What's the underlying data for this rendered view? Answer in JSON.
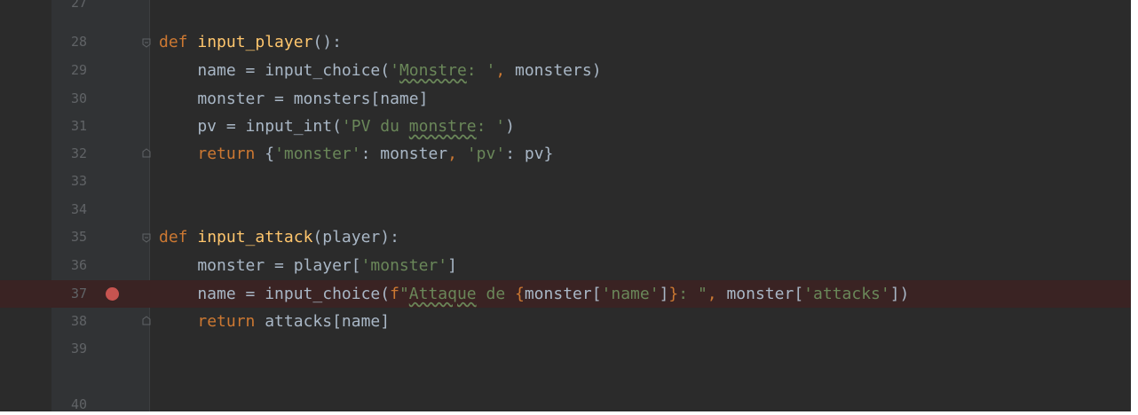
{
  "editor": {
    "colors": {
      "background": "#2b2b2b",
      "gutter": "#313335",
      "line_number": "#606366",
      "keyword": "#cc7832",
      "function_name": "#ffc66d",
      "string": "#6a8759",
      "default_text": "#a9b7c6",
      "breakpoint": "#c75450",
      "breakpoint_line": "#3a2323"
    },
    "lines": [
      {
        "number": "27",
        "text": ""
      },
      {
        "number": "28",
        "text": "def input_player():"
      },
      {
        "number": "29",
        "text": "    name = input_choice('Monstre: ', monsters)"
      },
      {
        "number": "30",
        "text": "    monster = monsters[name]"
      },
      {
        "number": "31",
        "text": "    pv = input_int('PV du monstre: ')"
      },
      {
        "number": "32",
        "text": "    return {'monster': monster, 'pv': pv}"
      },
      {
        "number": "33",
        "text": ""
      },
      {
        "number": "34",
        "text": ""
      },
      {
        "number": "35",
        "text": "def input_attack(player):"
      },
      {
        "number": "36",
        "text": "    monster = player['monster']"
      },
      {
        "number": "37",
        "text": "    name = input_choice(f\"Attaque de {monster['name']}: \", monster['attacks'])",
        "breakpoint": true
      },
      {
        "number": "38",
        "text": "    return attacks[name]"
      },
      {
        "number": "39",
        "text": ""
      },
      {
        "number": "40",
        "text": ""
      }
    ]
  }
}
